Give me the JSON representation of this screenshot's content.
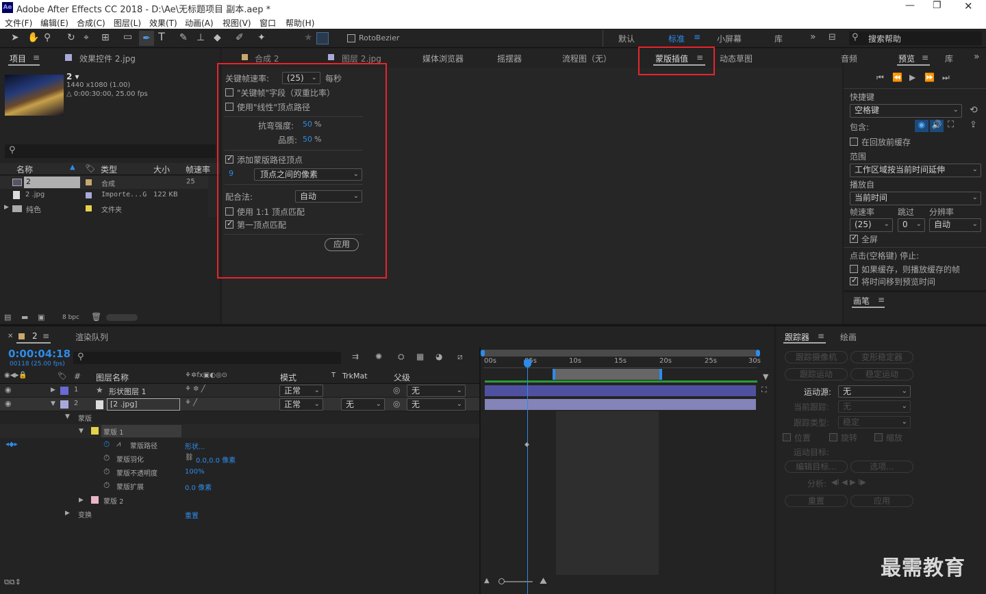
{
  "app": {
    "title": "Adobe After Effects CC 2018 - D:\\Ae\\无标题项目 副本.aep *",
    "logo": "Ae"
  },
  "menu": [
    "文件(F)",
    "编辑(E)",
    "合成(C)",
    "图层(L)",
    "效果(T)",
    "动画(A)",
    "视图(V)",
    "窗口",
    "帮助(H)"
  ],
  "toolbar": {
    "rotobezier": "RotoBezier",
    "workspaces": [
      "默认",
      "标准",
      "小屏幕",
      "库"
    ],
    "search_placeholder": "搜索帮助"
  },
  "project": {
    "tab_project": "项目",
    "tab_effects": "效果控件 2.jpg",
    "comp_name": "2 ▾",
    "comp_size": "1440 x1080 (1.00)",
    "comp_duration": "△ 0:00:30:00, 25.00 fps",
    "columns": [
      "名称",
      "类型",
      "大小",
      "帧速率"
    ],
    "rows": [
      {
        "name": "2",
        "type": "合成",
        "size": "",
        "fps": "25"
      },
      {
        "name": "2 .jpg",
        "type": "Importe...G",
        "size": "122 KB",
        "fps": ""
      },
      {
        "name": "纯色",
        "type": "文件夹",
        "size": "",
        "fps": ""
      }
    ],
    "bpc": "8 bpc"
  },
  "center_tabs": [
    "合成 2",
    "图层 2.jpg",
    "媒体浏览器",
    "摇摆器",
    "流程图（无）",
    "蒙版插值",
    "动态草图"
  ],
  "mask_interp": {
    "keyframe_rate_label": "关键帧速率:",
    "keyframe_rate_value": "(25)",
    "per_second": "每秒",
    "keyframe_fields": "\"关键帧\"字段（双重比率）",
    "linear_path": "使用\"线性\"顶点路径",
    "bend_label": "抗弯强度:",
    "bend_value": "50",
    "quality_label": "品质:",
    "quality_value": "50",
    "pct": "%",
    "add_vertices": "添加蒙版路径顶点",
    "vertex_count": "9",
    "vertex_mode": "顶点之间的像素",
    "match_label": "配合法:",
    "match_value": "自动",
    "one_to_one": "使用 1:1 顶点匹配",
    "first_vertex": "第一顶点匹配",
    "apply": "应用"
  },
  "preview": {
    "tab_mix": "音频",
    "tab_preview": "预览",
    "tab_lib": "库",
    "shortcut_label": "快捷键",
    "shortcut_value": "空格键",
    "include_label": "包含:",
    "cache_before": "在回放前缓存",
    "range_label": "范围",
    "range_value": "工作区域按当前时间延伸",
    "play_from_label": "播放自",
    "play_from_value": "当前时间",
    "fps_label": "帧速率",
    "skip_label": "跳过",
    "res_label": "分辨率",
    "fps_value": "(25)",
    "skip_value": "0",
    "res_value": "自动",
    "fullscreen": "全屏",
    "stop_label": "点击(空格键) 停止:",
    "if_cached": "如果缓存，则播放缓存的帧",
    "move_time": "将时间移到预览时间",
    "brush_tab": "画笔"
  },
  "timeline": {
    "tab": "2",
    "render_queue": "渲染队列",
    "timecode": "0:00:04:18",
    "frames": "00118 (25.00 fps)",
    "columns": [
      "图层名称",
      "模式",
      "T",
      "TrkMat",
      "父级"
    ],
    "layers": [
      {
        "num": "1",
        "name": "形状图层 1",
        "mode": "正常",
        "trkmat": "",
        "parent": "无"
      },
      {
        "num": "2",
        "name": "[2 .jpg]",
        "mode": "正常",
        "trkmat": "无",
        "parent": "无"
      }
    ],
    "props": [
      {
        "name": "蒙版",
        "value": ""
      },
      {
        "name": "蒙版 1",
        "value": ""
      },
      {
        "name": "蒙版路径",
        "value": "形状..."
      },
      {
        "name": "蒙版羽化",
        "value": "0.0,0.0 像素"
      },
      {
        "name": "蒙版不透明度",
        "value": "100%"
      },
      {
        "name": "蒙版扩展",
        "value": "0.0 像素"
      },
      {
        "name": "蒙版 2",
        "value": ""
      },
      {
        "name": "变换",
        "value": "重置"
      }
    ],
    "ruler": [
      "00s",
      "05s",
      "10s",
      "15s",
      "20s",
      "25s",
      "30s"
    ]
  },
  "tracker": {
    "tab_tracker": "跟踪器",
    "tab_paint": "绘画",
    "track_camera": "跟踪摄像机",
    "warp_stab": "变形稳定器",
    "track_motion": "跟踪运动",
    "stab_motion": "稳定运动",
    "motion_source_label": "运动源:",
    "motion_source_value": "无",
    "current_track_label": "当前跟踪:",
    "current_track_value": "无",
    "track_type_label": "跟踪类型:",
    "track_type_value": "稳定",
    "position": "位置",
    "rotation": "旋转",
    "scale": "缩放",
    "motion_target": "运动目标:",
    "edit_target": "编辑目标...",
    "options": "选项...",
    "analyze": "分析:",
    "reset": "重置",
    "apply": "应用"
  },
  "watermark": "最需教育",
  "colors": {
    "accent": "#2d8ceb",
    "highlight_box": "#e8252a",
    "panel": "#232323"
  }
}
